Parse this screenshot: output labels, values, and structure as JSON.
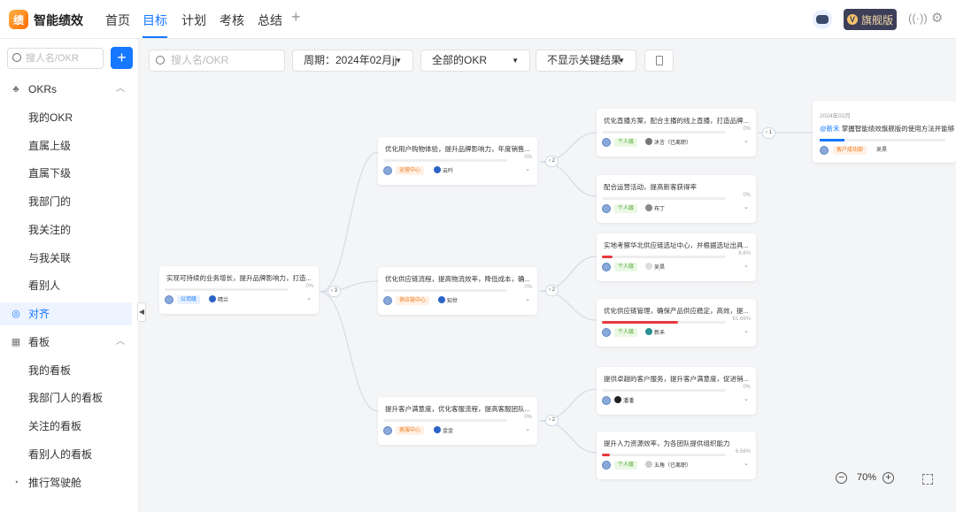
{
  "app": {
    "logo_text": "绩",
    "name": "智能绩效"
  },
  "nav": {
    "tabs": [
      "首页",
      "目标",
      "计划",
      "考核",
      "总结"
    ],
    "active": "目标",
    "add": "+"
  },
  "header_right": {
    "plan_label": "旗舰版",
    "plan_icon": "V"
  },
  "sidebar": {
    "search_placeholder": "搜人名/OKR",
    "add_label": "+",
    "okrs_label": "OKRs",
    "okrs_items": [
      "我的OKR",
      "直属上级",
      "直属下级",
      "我部门的",
      "我关注的",
      "与我关联",
      "看别人"
    ],
    "align_label": "对齐",
    "board_label": "看板",
    "board_items": [
      "我的看板",
      "我部门人的看板",
      "关注的看板",
      "看别人的看板"
    ],
    "cockpit_label": "推行驾驶舱"
  },
  "filters": {
    "search_placeholder": "搜人名/OKR",
    "period": "周期：2024年02月jj",
    "scope": "全部的OKR",
    "kr_display": "不显示关键结果"
  },
  "tree": {
    "root": {
      "title": "实现可持续的业务增长，提升品牌影响力，打造...",
      "pct": "0%",
      "tag": "公司级",
      "user": "晴兰",
      "children": "3"
    },
    "level2": [
      {
        "title": "优化用户购物体验，提升品牌影响力，年度销售...",
        "pct": "0%",
        "tag": "运营中心",
        "user": "云吟",
        "children": "2"
      },
      {
        "title": "优化供应链流程，提高物流效率，降低成本，确...",
        "pct": "0%",
        "tag": "供应链中心",
        "user": "知世",
        "children": "2"
      },
      {
        "title": "提升客户满意度，优化客服流程，提高客服团队...",
        "pct": "0%",
        "tag": "客服中心",
        "user": "金金",
        "children": "2"
      }
    ],
    "level3": [
      {
        "title": "优化直播方案，配合主播的线上直播，打造品牌...",
        "pct": "0%",
        "progress": 0,
        "tag": "个人级",
        "user": "沐言（已离职）",
        "children": "1"
      },
      {
        "title": "配合运营活动，提高新客获得率",
        "pct": "0%",
        "progress": 0,
        "tag": "个人级",
        "user": "布丁"
      },
      {
        "title": "实地考察华北供应链选址中心，并根据选址出具...",
        "pct": "8.6%",
        "progress": 8.6,
        "tag": "个人级",
        "user": "吴昊"
      },
      {
        "title": "优化供应链管理，确保产品供应稳定，高效，提...",
        "pct": "61.66%",
        "progress": 61.66,
        "tag": "个人级",
        "user": "新禾"
      },
      {
        "title": "提供卓越的客户服务，提升客户满意度，促进销...",
        "pct": "0%",
        "progress": 0,
        "tag": "个人级",
        "user": "潘潘"
      },
      {
        "title": "提升人力资源效率，为各团队提供组织能力",
        "pct": "6.66%",
        "progress": 6.66,
        "tag": "个人级",
        "user": "五角（已离职）"
      }
    ],
    "level4": {
      "date": "2024年02月",
      "prefix": "@新禾",
      "title": "掌握智能绩效旗舰版的使用方法并能够",
      "progress": 20,
      "tag": "客户成功部",
      "user": "吴昊"
    }
  },
  "zoom": {
    "level": "70%",
    "minus": "−",
    "plus": "+"
  },
  "colors": {
    "accent": "#1677ff",
    "danger": "#e8383d"
  }
}
